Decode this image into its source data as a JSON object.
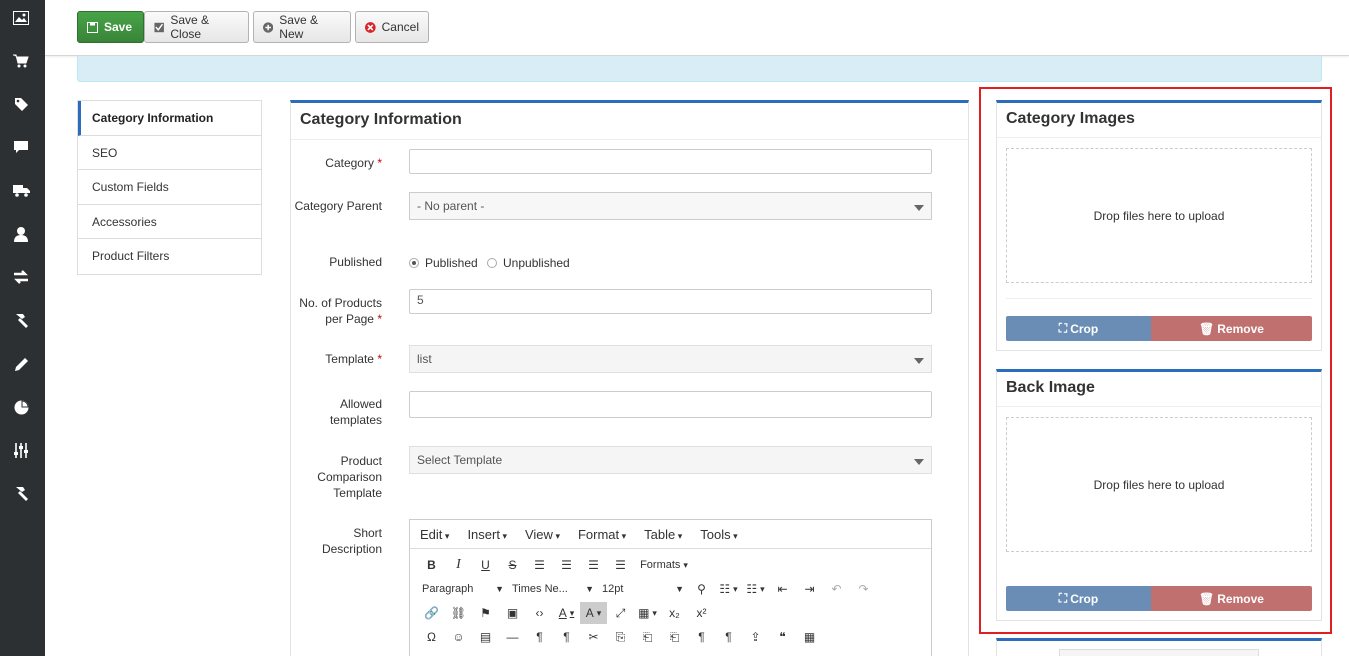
{
  "toolbar": {
    "save": "Save",
    "save_close": "Save & Close",
    "save_new": "Save & New",
    "cancel": "Cancel"
  },
  "sidebar_icons": [
    "image-icon",
    "cart-icon",
    "tag-icon",
    "comment-icon",
    "truck-icon",
    "user-icon",
    "exchange-icon",
    "hammer-icon",
    "pencil-icon",
    "pie-chart-icon",
    "sliders-icon",
    "hammer-icon"
  ],
  "tabs": [
    "Category Information",
    "SEO",
    "Custom Fields",
    "Accessories",
    "Product Filters"
  ],
  "form": {
    "title": "Category Information",
    "category_label": "Category",
    "category_value": "",
    "parent_label": "Category Parent",
    "parent_value": "- No parent -",
    "published_label": "Published",
    "published_option": "Published",
    "unpublished_option": "Unpublished",
    "products_per_page_label": "No. of Products per Page",
    "products_per_page_value": "5",
    "template_label": "Template",
    "template_value": "list",
    "allowed_templates_label": "Allowed templates",
    "comparison_label": "Product Comparison Template",
    "comparison_value": "Select Template",
    "short_desc_label": "Short Description"
  },
  "editor": {
    "menus": [
      "Edit",
      "Insert",
      "View",
      "Format",
      "Table",
      "Tools"
    ],
    "formats": "Formats",
    "paragraph": "Paragraph",
    "font": "Times Ne...",
    "size": "12pt"
  },
  "images": {
    "category_title": "Category Images",
    "back_title": "Back Image",
    "drop_text": "Drop files here to upload",
    "crop": "Crop",
    "remove": "Remove"
  },
  "colors": {
    "save_green": "#47a447",
    "accent_blue": "#2a6ebb",
    "highlight_red": "#e02020",
    "crop_blue": "#6a8db5",
    "remove_red": "#c0716f"
  }
}
